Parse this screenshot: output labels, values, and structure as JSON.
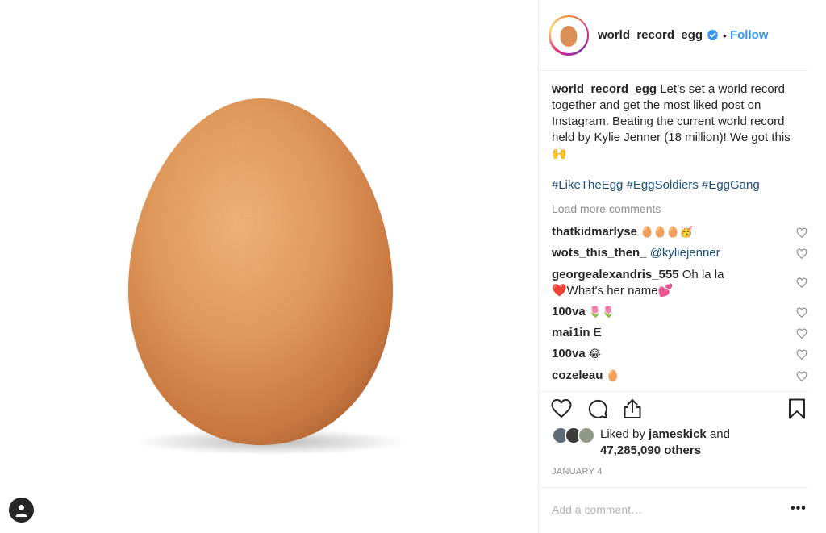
{
  "post": {
    "username": "world_record_egg",
    "follow_label": "Follow",
    "separator": "•",
    "caption_text": "Let’s set a world record together and get the most liked post on Instagram. Beating the current world record held by Kylie Jenner (18 million)! We got this 🙌",
    "hashtags": [
      "#LikeTheEgg",
      "#EggSoldiers",
      "#EggGang"
    ],
    "load_more_label": "Load more comments"
  },
  "comments": [
    {
      "user": "thatkidmarlyse",
      "text": "🥚🥚🥚🥳"
    },
    {
      "user": "wots_this_then_",
      "text": "@kyliejenner"
    },
    {
      "user": "georgealexandris_555",
      "text": "Oh la la ❤️What's her name💕"
    },
    {
      "user": "100va",
      "text": "🌷🌷"
    },
    {
      "user": "mai1in",
      "text": "E"
    },
    {
      "user": "100va",
      "text": "😂"
    },
    {
      "user": "cozeleau",
      "text": "🥚"
    }
  ],
  "likes": {
    "prefix": "Liked by",
    "user": "jameskick",
    "and": "and",
    "count": "47,285,090 others"
  },
  "date": "JANUARY 4",
  "comment_box": {
    "placeholder": "Add a comment…",
    "more_label": "•••"
  },
  "colors": {
    "link_blue": "#3897f0",
    "hashtag_blue": "#1b4f7e",
    "muted": "#8e8e8e",
    "egg": "#e59a5a"
  },
  "icons": {
    "heart": "heart-icon",
    "comment": "comment-icon",
    "share": "share-icon",
    "bookmark": "bookmark-icon",
    "verified": "verified-badge-icon",
    "profile": "profile-icon"
  }
}
